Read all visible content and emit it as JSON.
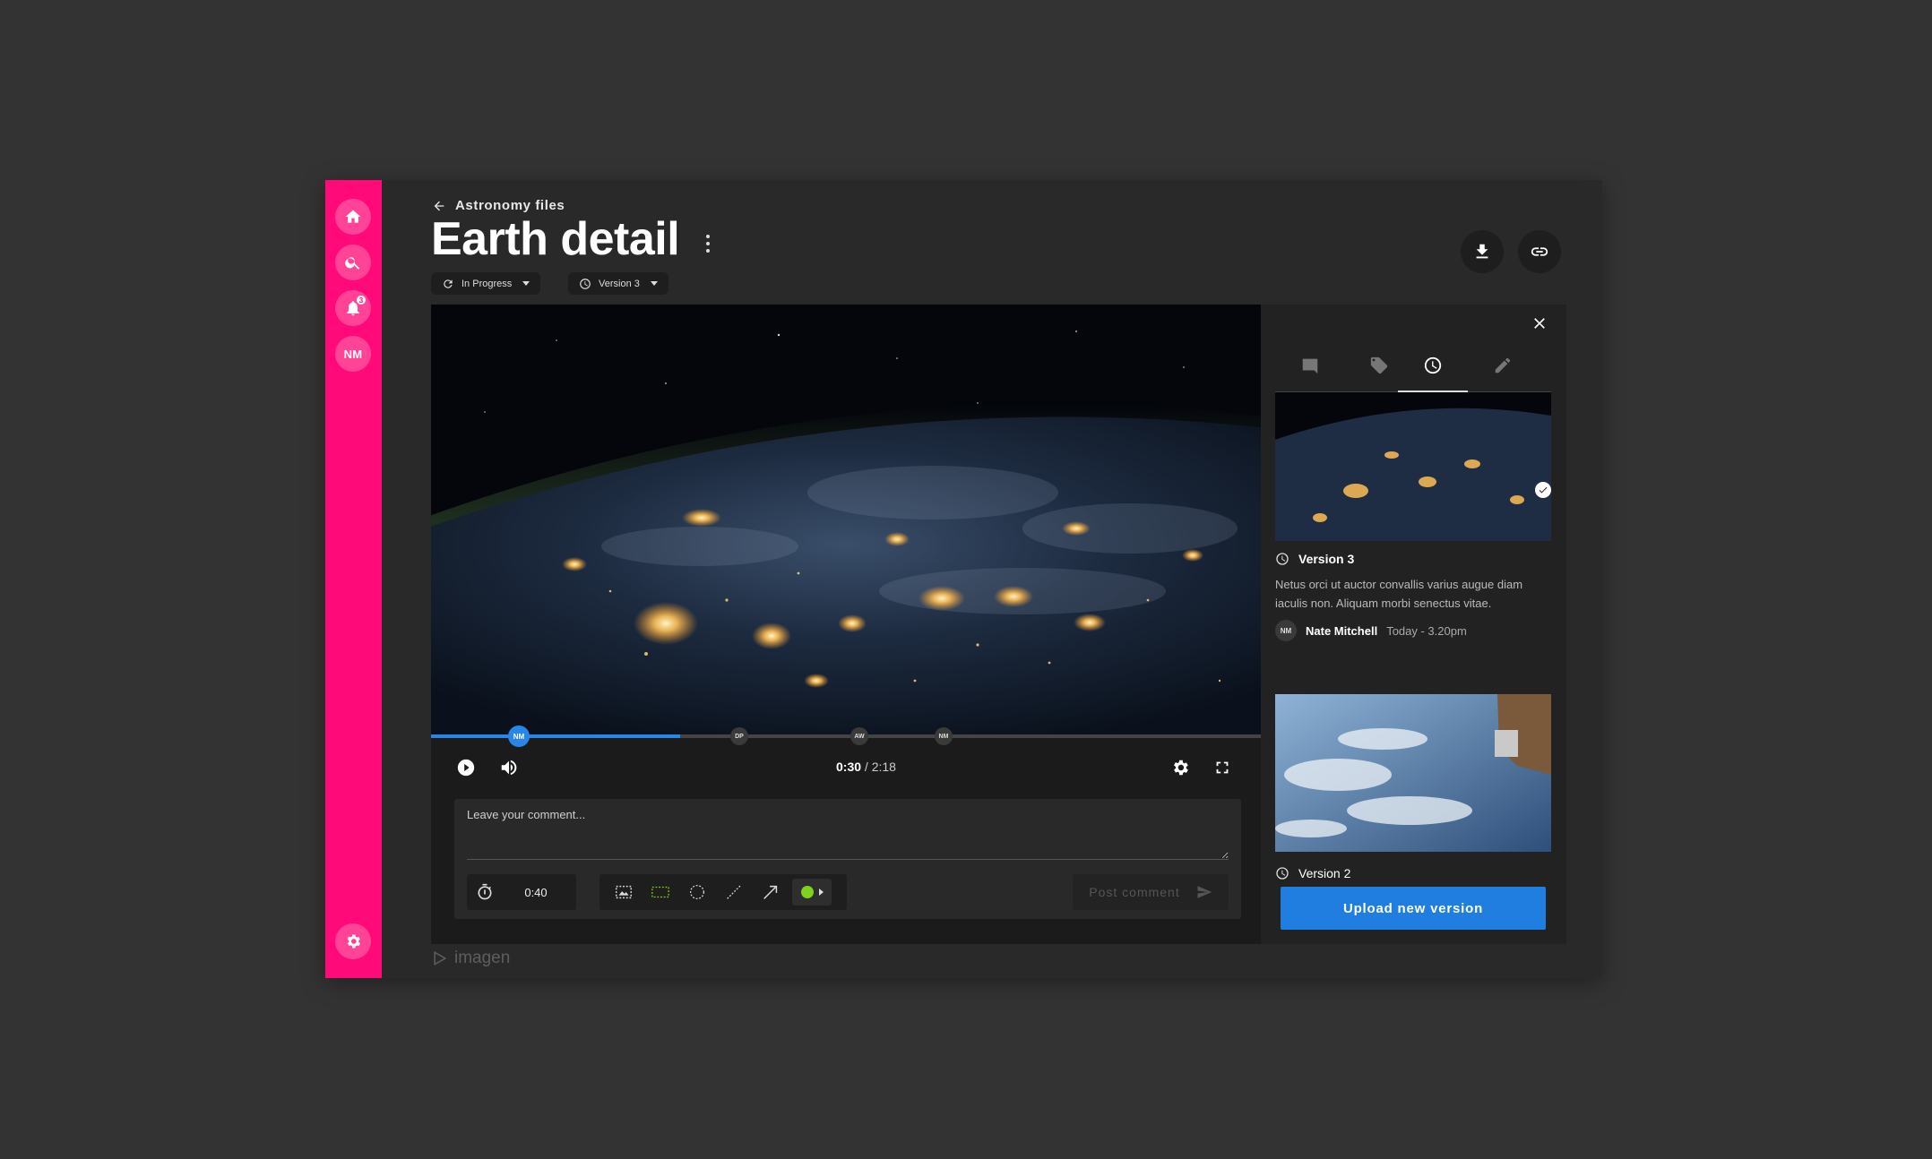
{
  "nav": {
    "items": [
      {
        "icon": "home-icon"
      },
      {
        "icon": "search-icon"
      },
      {
        "icon": "bell-icon",
        "badge": "3"
      }
    ],
    "user_initials": "NM",
    "settings_icon": "gear-icon",
    "accent_color": "#ff0a78"
  },
  "header": {
    "breadcrumb": "Astronomy files",
    "title": "Earth detail",
    "status_label": "In Progress",
    "version_label": "Version 3",
    "download_icon": "download-icon",
    "link_icon": "link-icon"
  },
  "player": {
    "current_time": "0:30",
    "separator": " / ",
    "total_time": "2:18",
    "progress_fraction": 0.3,
    "markers": [
      {
        "initials": "NM",
        "active": true
      },
      {
        "initials": "DP",
        "active": false
      },
      {
        "initials": "AW",
        "active": false
      },
      {
        "initials": "NM",
        "active": false
      }
    ]
  },
  "comment": {
    "placeholder": "Leave your comment...",
    "timestamp": "0:40",
    "post_label": "Post comment",
    "draw_color": "#7fd11b"
  },
  "panel": {
    "tabs": [
      {
        "icon": "comment-icon",
        "active": false
      },
      {
        "icon": "tag-icon",
        "active": false
      },
      {
        "icon": "clock-icon",
        "active": true
      },
      {
        "icon": "pencil-icon",
        "active": false
      }
    ],
    "versions": [
      {
        "title": "Version 3",
        "description": "Netus orci ut auctor convallis varius augue diam iaculis non. Aliquam morbi senectus vitae.",
        "author_initials": "NM",
        "author": "Nate Mitchell",
        "time": "Today - 3.20pm",
        "selected": true
      },
      {
        "title": "Version 2"
      }
    ],
    "upload_label": "Upload new version",
    "upload_color": "#1f7ee0"
  },
  "footer": {
    "brand": "imagen"
  }
}
